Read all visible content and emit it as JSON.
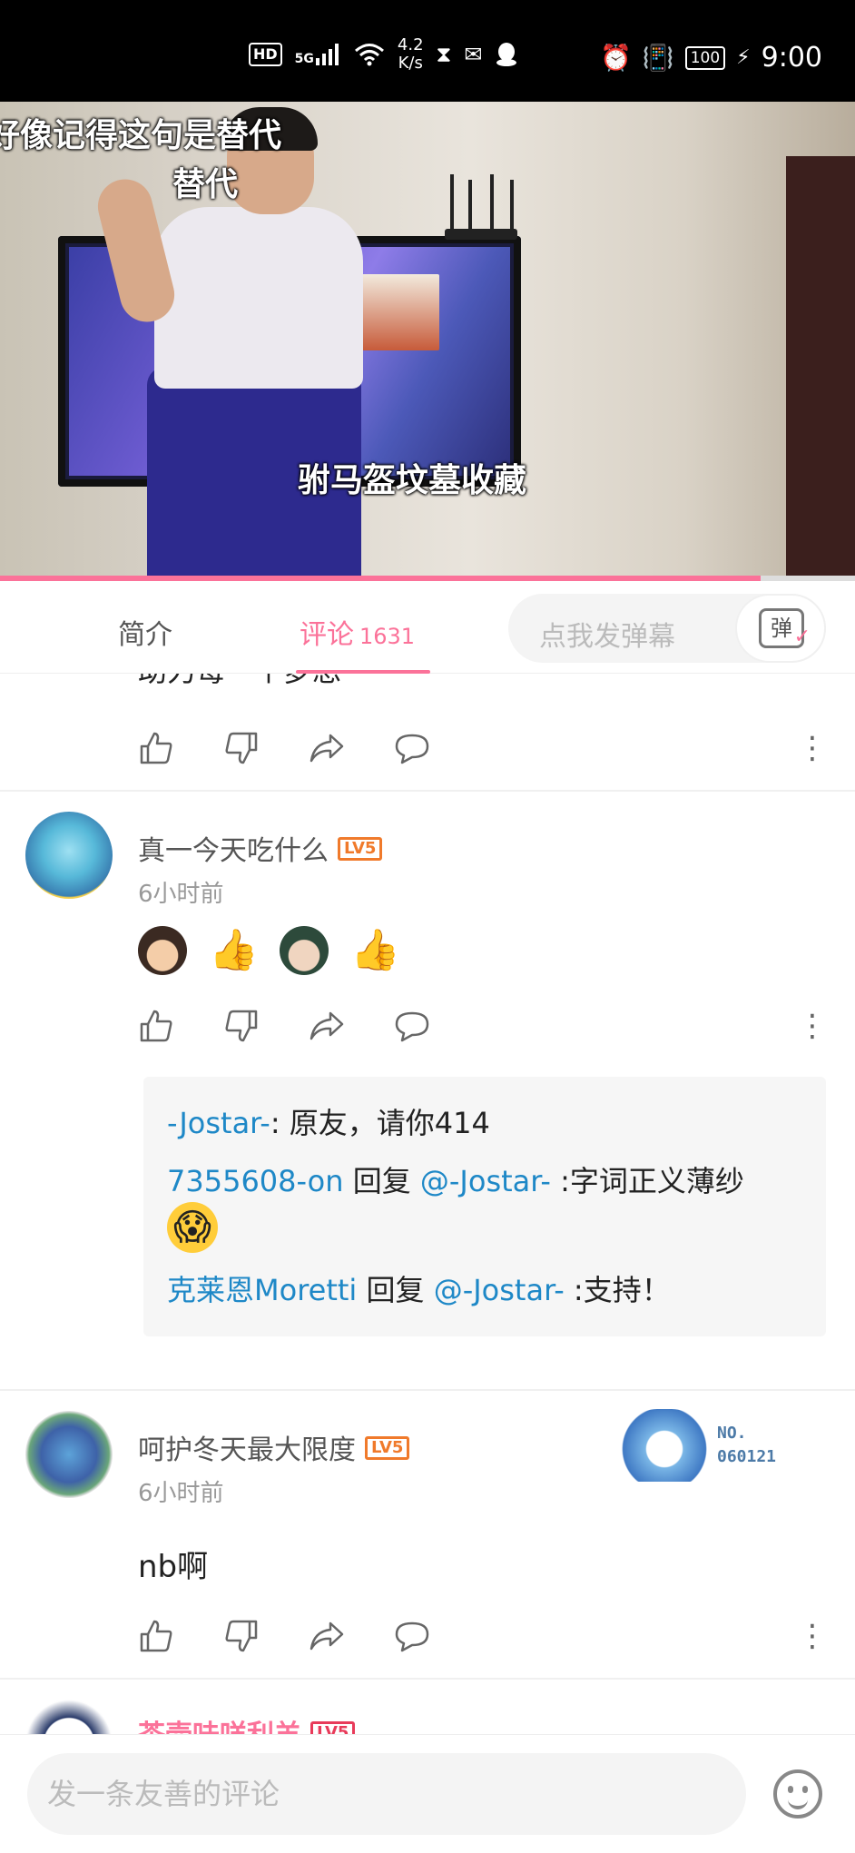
{
  "status_bar": {
    "hd": "HD",
    "network": "5G",
    "speed_value": "4.2",
    "speed_unit": "K/s",
    "battery": "100",
    "time": "9:00"
  },
  "video": {
    "subtitle_top_line1": "好像记得这句是替代",
    "subtitle_top_line2": "替代",
    "subtitle_mid": "驸马盔坟墓收藏",
    "progress_fraction": 0.89,
    "progress_color": "#fb7299"
  },
  "tabs": {
    "intro": "简介",
    "comments": "评论",
    "comments_count": "1631",
    "danmu_placeholder": "点我发弹幕",
    "danmu_button": "弹"
  },
  "comments": {
    "clipped_text": "助力每一个梦想",
    "items": [
      {
        "username": "真一今天吃什么",
        "level": "LV5",
        "time": "6小时前",
        "emojis": [
          "face-emoji",
          "👍",
          "face-emoji",
          "👍"
        ],
        "replies": [
          {
            "user": "-Jostar-",
            "text": ": 原友，请你414"
          },
          {
            "user": "7355608-on",
            "mid": " 回复 ",
            "target": "@-Jostar-",
            "text": " :字词正义薄纱",
            "emoji": "😱"
          },
          {
            "user": "克莱恩Moretti",
            "mid": " 回复 ",
            "target": "@-Jostar-",
            "text": " :支持！"
          }
        ]
      },
      {
        "username": "呵护冬天最大限度",
        "level": "LV5",
        "time": "6小时前",
        "text": "nb啊",
        "badge_line1": "NO.",
        "badge_line2": "060121"
      },
      {
        "username": "茶壶味咩利羊",
        "level": "LV5"
      }
    ]
  },
  "bottom_bar": {
    "input_placeholder": "发一条友善的评论"
  },
  "colors": {
    "accent": "#fb7299",
    "link": "#1e88c7",
    "level": "#f07a2b"
  }
}
